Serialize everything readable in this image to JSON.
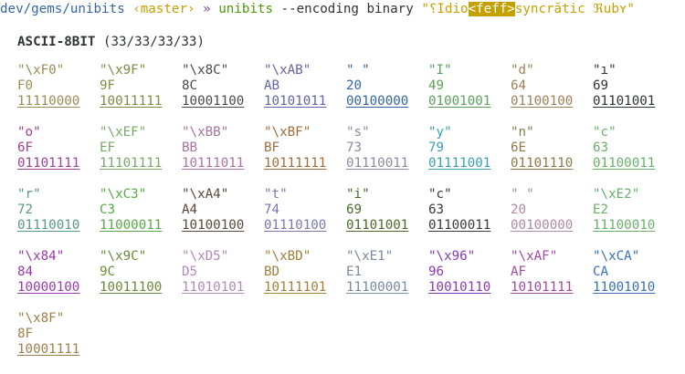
{
  "prompt": {
    "path": "dev/gems/unibits",
    "branch": "‹master›",
    "arrow": "»",
    "command": "unibits",
    "args": "--encoding binary",
    "string_open": "\"",
    "string_part1": "⸮Idio",
    "bom": "<feff>",
    "string_part2": "syncrătic ℜubʏ",
    "string_close": "\""
  },
  "header": {
    "encoding": "ASCII-8BIT",
    "counts": "(33/33/33/33)"
  },
  "colors": {
    "c1": "#9a8c54",
    "c2": "#78a06e",
    "c3": "#3a3a3a",
    "c4": "#6c6cb0",
    "c5": "#b0887a",
    "c6": "#2ca02c",
    "c7": "#a46c3a",
    "c8": "#b44ca4",
    "c9": "#7a7a9a",
    "c10": "#3aa0b0",
    "c11": "#7070c0",
    "c12": "#8a3ab8",
    "c13": "#3a70b8",
    "c14": "#5a4a2a"
  },
  "bytes": [
    {
      "char": "\"\\xF0\"",
      "hex": "F0",
      "bin": "11110000",
      "color": "#9a8c54"
    },
    {
      "char": "\"\\x9F\"",
      "hex": "9F",
      "bin": "10011111",
      "color": "#7f8c47"
    },
    {
      "char": "\"\\x8C\"",
      "hex": "8C",
      "bin": "10001100",
      "color": "#4a4a4a"
    },
    {
      "char": "\"\\xAB\"",
      "hex": "AB",
      "bin": "10101011",
      "color": "#6464a8"
    },
    {
      "char": "\" \"",
      "hex": "20",
      "bin": "00100000",
      "color": "#3465a4"
    },
    {
      "char": "\"I\"",
      "hex": "49",
      "bin": "01001001",
      "color": "#5aa05a"
    },
    {
      "char": "\"d\"",
      "hex": "64",
      "bin": "01100100",
      "color": "#a0805a"
    },
    {
      "char": "\"ı\"",
      "hex": "69",
      "bin": "01101001",
      "color": "#2e3436"
    },
    {
      "char": "\"o\"",
      "hex": "6F",
      "bin": "01101111",
      "color": "#a0409a"
    },
    {
      "char": "\"\\xEF\"",
      "hex": "EF",
      "bin": "11101111",
      "color": "#7aa86a"
    },
    {
      "char": "\"\\xBB\"",
      "hex": "BB",
      "bin": "10111011",
      "color": "#a874a0"
    },
    {
      "char": "\"\\xBF\"",
      "hex": "BF",
      "bin": "10111111",
      "color": "#a06c3a"
    },
    {
      "char": "\"s\"",
      "hex": "73",
      "bin": "01110011",
      "color": "#8a8aa0"
    },
    {
      "char": "\"y\"",
      "hex": "79",
      "bin": "01111001",
      "color": "#3aa0b0"
    },
    {
      "char": "\"n\"",
      "hex": "6E",
      "bin": "01101110",
      "color": "#8a7a4a"
    },
    {
      "char": "\"c\"",
      "hex": "63",
      "bin": "01100011",
      "color": "#6ab06a"
    },
    {
      "char": "\"r\"",
      "hex": "72",
      "bin": "01110010",
      "color": "#5a9a80"
    },
    {
      "char": "\"\\xC3\"",
      "hex": "C3",
      "bin": "11000011",
      "color": "#5aa84a"
    },
    {
      "char": "\"\\xA4\"",
      "hex": "A4",
      "bin": "10100100",
      "color": "#5a4a3a"
    },
    {
      "char": "\"t\"",
      "hex": "74",
      "bin": "01110100",
      "color": "#7a7ab0"
    },
    {
      "char": "\"i\"",
      "hex": "69",
      "bin": "01101001",
      "color": "#4a6a2a"
    },
    {
      "char": "\"c\"",
      "hex": "63",
      "bin": "01100011",
      "color": "#3a3a3a"
    },
    {
      "char": "\" \"",
      "hex": "20",
      "bin": "00100000",
      "color": "#b08aa0"
    },
    {
      "char": "\"\\xE2\"",
      "hex": "E2",
      "bin": "11100010",
      "color": "#6ab06a"
    },
    {
      "char": "\"\\x84\"",
      "hex": "84",
      "bin": "10000100",
      "color": "#9a3ab0"
    },
    {
      "char": "\"\\x9C\"",
      "hex": "9C",
      "bin": "10011100",
      "color": "#6a8a3a"
    },
    {
      "char": "\"\\xD5\"",
      "hex": "D5",
      "bin": "11010101",
      "color": "#b08ab8"
    },
    {
      "char": "\"\\xBD\"",
      "hex": "BD",
      "bin": "10111101",
      "color": "#a0803a"
    },
    {
      "char": "\"\\xE1\"",
      "hex": "E1",
      "bin": "11100001",
      "color": "#7a8aa0"
    },
    {
      "char": "\"\\x96\"",
      "hex": "96",
      "bin": "10010110",
      "color": "#8a3ab8"
    },
    {
      "char": "\"\\xAF\"",
      "hex": "AF",
      "bin": "10101111",
      "color": "#a04aa0"
    },
    {
      "char": "\"\\xCA\"",
      "hex": "CA",
      "bin": "11001010",
      "color": "#3a70b8"
    },
    {
      "char": "\"\\x8F\"",
      "hex": "8F",
      "bin": "10001111",
      "color": "#a0804a"
    }
  ]
}
